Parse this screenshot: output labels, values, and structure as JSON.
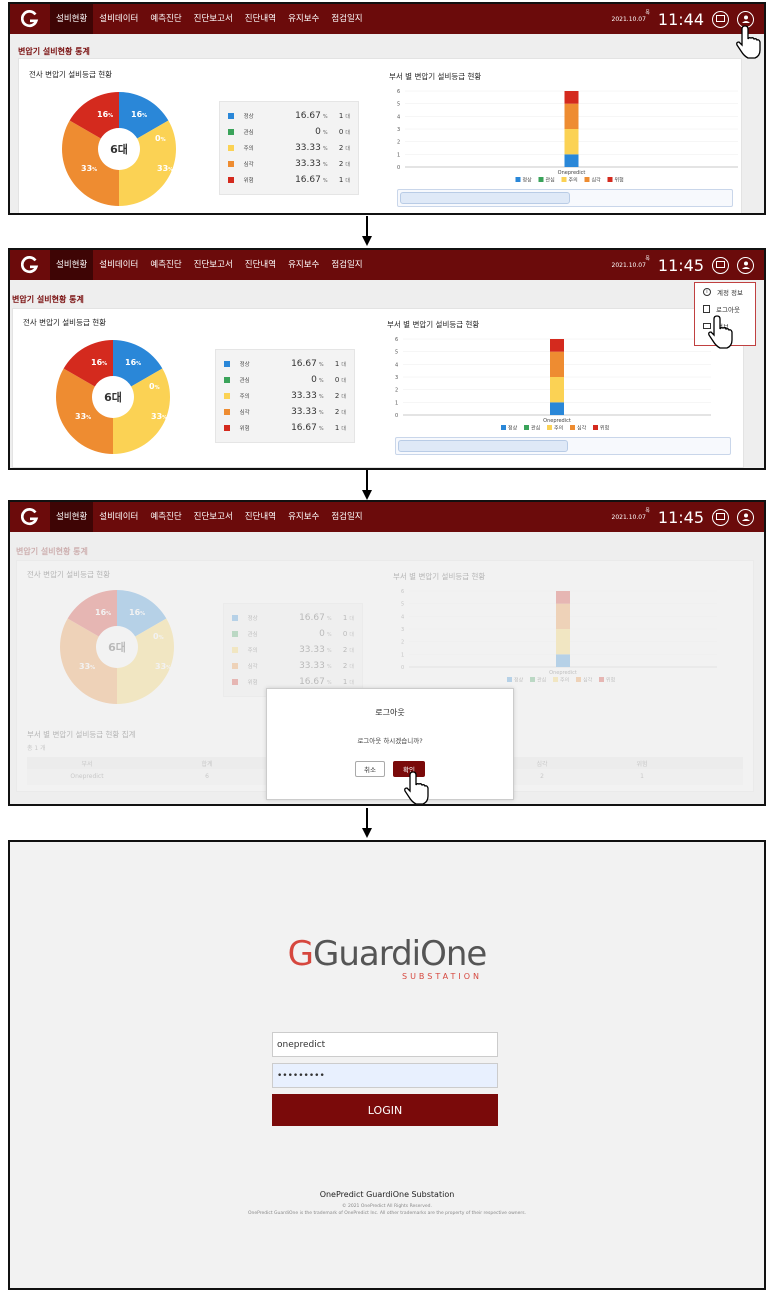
{
  "nav": {
    "items": [
      "설비현황",
      "설비데이터",
      "예측진단",
      "진단보고서",
      "진단내역",
      "유지보수",
      "점검일지"
    ],
    "active": "설비현황",
    "date": "2021.10.07",
    "date_sup": "목",
    "times": [
      "11:44",
      "11:45",
      "11:45"
    ]
  },
  "dashboard": {
    "page_title": "변압기 설비현황 통계",
    "donut_title": "전사 변압기 설비등급 현황",
    "donut_center": "6대",
    "bar_title": "부서 별 변압기 설비등급 현황",
    "bar_category": "Onepredict",
    "y_ticks": [
      "6",
      "5",
      "4",
      "3",
      "2",
      "1",
      "0"
    ],
    "pct_labels": [
      "16",
      "0",
      "33",
      "33",
      "16"
    ],
    "pct_unit": "%"
  },
  "legend": [
    {
      "name": "정상",
      "color": "#2a87d8",
      "pct": "16.67",
      "pct_unit": "%",
      "count": "1",
      "count_unit": "대"
    },
    {
      "name": "관심",
      "color": "#3aa35a",
      "pct": "0",
      "pct_unit": "%",
      "count": "0",
      "count_unit": "대"
    },
    {
      "name": "주의",
      "color": "#fbd254",
      "pct": "33.33",
      "pct_unit": "%",
      "count": "2",
      "count_unit": "대"
    },
    {
      "name": "심각",
      "color": "#ee8c31",
      "pct": "33.33",
      "pct_unit": "%",
      "count": "2",
      "count_unit": "대"
    },
    {
      "name": "위험",
      "color": "#d42a1e",
      "pct": "16.67",
      "pct_unit": "%",
      "count": "1",
      "count_unit": "대"
    }
  ],
  "chart_data": {
    "type": "bar",
    "categories": [
      "Onepredict"
    ],
    "series": [
      {
        "name": "정상",
        "values": [
          1
        ]
      },
      {
        "name": "관심",
        "values": [
          0
        ]
      },
      {
        "name": "주의",
        "values": [
          2
        ]
      },
      {
        "name": "심각",
        "values": [
          2
        ]
      },
      {
        "name": "위험",
        "values": [
          1
        ]
      }
    ],
    "ylim": [
      0,
      6
    ]
  },
  "dropdown": {
    "items": [
      "계정 정보",
      "로그아웃",
      "정보"
    ]
  },
  "modal": {
    "title": "로그아웃",
    "message": "로그아웃 하시겠습니까?",
    "cancel": "취소",
    "confirm": "확인"
  },
  "summary": {
    "title": "부서 별 변압기 설비등급 현황 집계",
    "sub": "총 1 개",
    "headers": [
      "부서",
      "합계",
      "",
      "",
      "심각",
      "위험"
    ],
    "row": [
      "Onepredict",
      "6",
      "",
      "",
      "2",
      "1"
    ]
  },
  "login": {
    "brand": "GuardiOne",
    "brand_sub": "SUBSTATION",
    "username": "onepredict",
    "password": "•••••••••",
    "button": "LOGIN",
    "footer": "OnePredict  GuardiOne  Substation",
    "copyright": "© 2021 OnePredict All Rights Reserved.",
    "trademark": "OnePredict GuardiOne is the trademark of OnePredict Inc. All other trademarks are the property of their respective owners."
  }
}
